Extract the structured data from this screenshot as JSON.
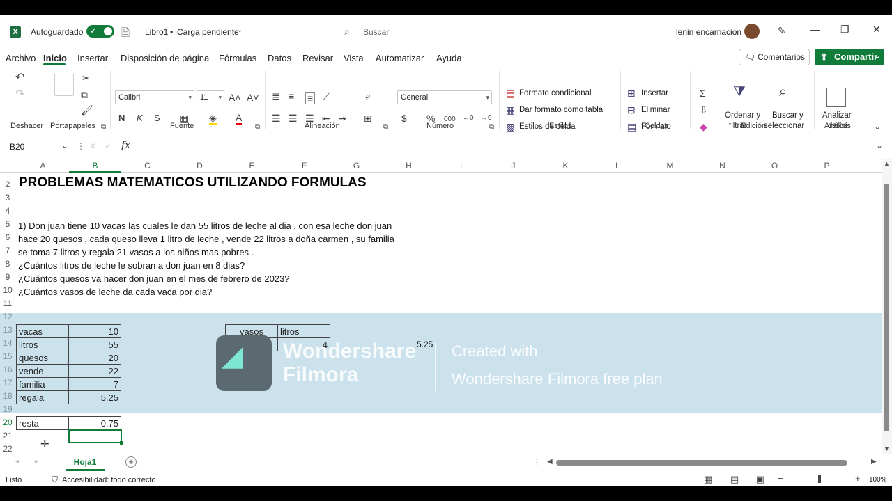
{
  "title": {
    "app_icon": "excel-icon",
    "autosave_label": "Autoguardado",
    "file_name": "Libro1",
    "save_status": "Carga pendiente",
    "search_placeholder": "Buscar",
    "user_name": "lenin encarnacion"
  },
  "menu": {
    "tabs": [
      "Archivo",
      "Inicio",
      "Insertar",
      "Disposición de página",
      "Fórmulas",
      "Datos",
      "Revisar",
      "Vista",
      "Automatizar",
      "Ayuda"
    ],
    "comments_label": "Comentarios",
    "share_label": "Compartir"
  },
  "ribbon": {
    "groups": {
      "undo": "Deshacer",
      "clipboard": "Portapapeles",
      "font": "Fuente",
      "alignment": "Alineación",
      "number": "Número",
      "styles": "Estilos",
      "cells": "Celdas",
      "editing": "Edición",
      "analysis": "Análisis"
    },
    "font_name": "Calibri",
    "font_size": "11",
    "number_format": "General",
    "bold": "N",
    "italic": "K",
    "underline": "S",
    "conditional_format": "Formato condicional",
    "format_table": "Dar formato como tabla",
    "cell_styles": "Estilos de celda",
    "insert": "Insertar",
    "delete": "Eliminar",
    "format": "Formato",
    "sort_filter_1": "Ordenar y",
    "sort_filter_2": "filtrar",
    "find_select_1": "Buscar y",
    "find_select_2": "seleccionar",
    "analyze_1": "Analizar",
    "analyze_2": "datos"
  },
  "formula_bar": {
    "name_box": "B20",
    "fx": "fx",
    "value": ""
  },
  "grid": {
    "columns": [
      "A",
      "B",
      "C",
      "D",
      "E",
      "F",
      "G",
      "H",
      "I",
      "J",
      "K",
      "L",
      "M",
      "N",
      "O",
      "P"
    ],
    "rows": [
      "2",
      "3",
      "4",
      "5",
      "6",
      "7",
      "8",
      "9",
      "10",
      "11",
      "12",
      "13",
      "14",
      "15",
      "16",
      "17",
      "18",
      "19",
      "20",
      "21",
      "22"
    ],
    "title": "PROBLEMAS MATEMATICOS UTILIZANDO FORMULAS",
    "problem_lines": [
      "1) Don juan tiene 10 vacas las cuales le dan 55 litros de leche al dia , con esa leche don juan",
      "hace 20 quesos , cada queso lleva 1 litro de leche , vende 22 litros a doña carmen , su familia",
      "se toma 7 litros y regala 21 vasos a los niños mas pobres .",
      "¿Cuántos litros de leche le sobran a don juan en  8 dias?",
      "¿Cuántos quesos va hacer don juan en el mes de febrero de 2023?",
      "¿Cuántos vasos de leche da cada vaca por dia?"
    ],
    "table1": [
      {
        "label": "vacas",
        "value": "10"
      },
      {
        "label": "litros",
        "value": "55"
      },
      {
        "label": "quesos",
        "value": "20"
      },
      {
        "label": "vende",
        "value": "22"
      },
      {
        "label": "familia",
        "value": "7"
      },
      {
        "label": "regala",
        "value": "5.25"
      }
    ],
    "table2": {
      "headers": [
        "vasos",
        "litros"
      ],
      "values": [
        "21",
        "4"
      ]
    },
    "side_value": "5.25",
    "resta": {
      "label": "resta",
      "value": "0.75"
    }
  },
  "watermark": {
    "brand_1": "Wondershare",
    "brand_2": "Filmora",
    "line_1": "Created with",
    "line_2": "Wondershare Filmora free plan"
  },
  "sheet_tabs": {
    "active": "Hoja1"
  },
  "status": {
    "ready": "Listo",
    "accessibility": "Accesibilidad: todo correcto",
    "zoom": "100%"
  }
}
